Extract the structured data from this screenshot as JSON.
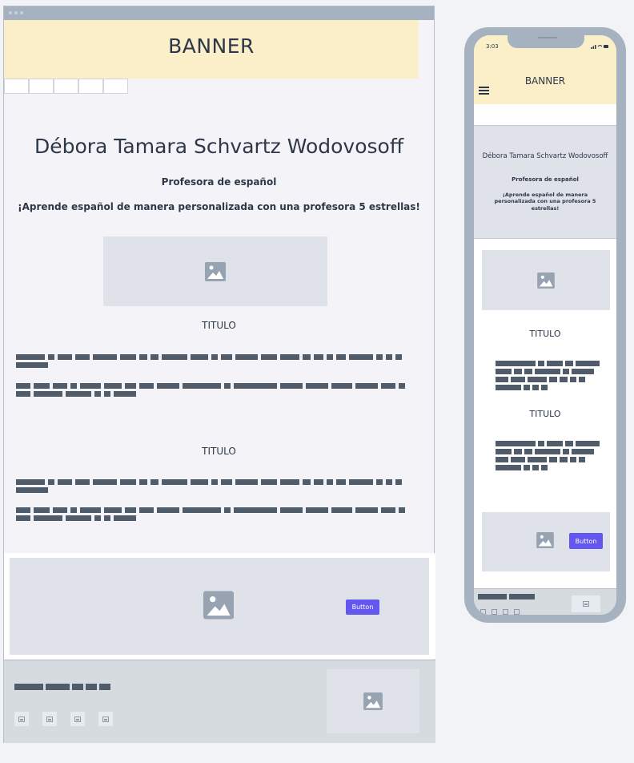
{
  "desktop": {
    "banner_title": "BANNER",
    "nav_tab_count": 5,
    "hero": {
      "name": "Débora Tamara Schvartz Wodovosoff",
      "subtitle": "Profesora de español",
      "tagline": "¡Aprende español de manera personalizada con una profesora 5 estrellas!"
    },
    "sections": [
      {
        "title": "TITULO"
      },
      {
        "title": "TITULO"
      }
    ],
    "cta": {
      "button_label": "Button"
    }
  },
  "mobile": {
    "status_time": "3:03",
    "banner_title": "BANNER",
    "hero": {
      "name": "Débora Tamara Schvartz Wodovosoff",
      "subtitle": "Profesora de español",
      "tagline": "¡Aprende español de manera personalizada con una profesora 5 estrellas!"
    },
    "sections": [
      {
        "title": "TITULO"
      },
      {
        "title": "TITULO"
      }
    ],
    "cta": {
      "button_label": "Button"
    }
  },
  "icons": {
    "image_placeholder": "image-icon",
    "menu": "hamburger-menu-icon"
  },
  "colors": {
    "banner": "#fbefc9",
    "button": "#6457f0",
    "frame": "#a6b2bf",
    "placeholder": "#dfe2e9",
    "text_block": "#505c6a"
  }
}
